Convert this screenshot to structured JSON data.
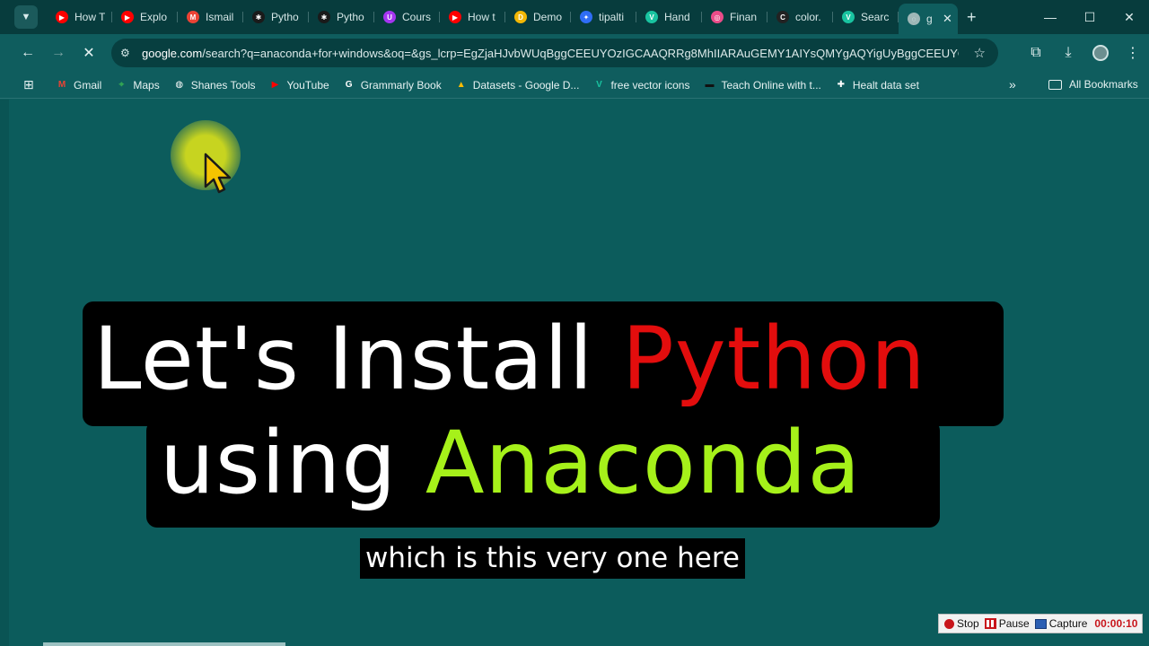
{
  "browser": {
    "tabs": [
      {
        "label": "How T",
        "icon": "youtube-icon",
        "color": "#ff0000",
        "glyph": "▶"
      },
      {
        "label": "Explo",
        "icon": "youtube-icon",
        "color": "#ff0000",
        "glyph": "▶"
      },
      {
        "label": "Ismail",
        "icon": "gmail-icon",
        "color": "#ea4335",
        "glyph": "M"
      },
      {
        "label": "Pytho",
        "icon": "openai-icon",
        "color": "#1a1a1a",
        "glyph": "✱"
      },
      {
        "label": "Pytho",
        "icon": "openai-icon",
        "color": "#1a1a1a",
        "glyph": "✱"
      },
      {
        "label": "Cours",
        "icon": "udemy-icon",
        "color": "#a435f0",
        "glyph": "U"
      },
      {
        "label": "How t",
        "icon": "youtube-icon",
        "color": "#ff0000",
        "glyph": "▶"
      },
      {
        "label": "Demo",
        "icon": "demo-icon",
        "color": "#f2b705",
        "glyph": "D"
      },
      {
        "label": "tipalti",
        "icon": "tipalti-icon",
        "color": "#2f6df6",
        "glyph": "✦"
      },
      {
        "label": "Hand",
        "icon": "vectorify-icon",
        "color": "#19c3a0",
        "glyph": "V"
      },
      {
        "label": "Finan",
        "icon": "dribbble-icon",
        "color": "#ea4c89",
        "glyph": "◎"
      },
      {
        "label": "color.",
        "icon": "coolors-icon",
        "color": "#222222",
        "glyph": "C"
      },
      {
        "label": "Searc",
        "icon": "vectorify-icon",
        "color": "#19c3a0",
        "glyph": "V"
      },
      {
        "label": "g",
        "icon": "loading-icon",
        "color": "#9fb7b7",
        "glyph": "◌",
        "active": true
      }
    ],
    "new_tab": "+",
    "window_controls": [
      "—",
      "☐",
      "✕"
    ],
    "url_domain": "google.com",
    "url_rest": "/search?q=anaconda+for+windows&oq=&gs_lcrp=EgZjaHJvbWUqBggCEEUYOzIGCAAQRRg8MhIIARAuGEMY1AIYsQMYgAQYigUyBggCEEUYOzI...",
    "bookmarks": [
      {
        "label": "Gmail",
        "icon": "gmail-icon",
        "color": "#ea4335",
        "glyph": "M"
      },
      {
        "label": "Maps",
        "icon": "maps-icon",
        "color": "#34a853",
        "glyph": "⌖"
      },
      {
        "label": "Shanes Tools",
        "icon": "globe-icon",
        "color": "#ffffff",
        "glyph": "◍"
      },
      {
        "label": "YouTube",
        "icon": "youtube-icon",
        "color": "#ff0000",
        "glyph": "▶"
      },
      {
        "label": "Grammarly Book",
        "icon": "grammarly-icon",
        "color": "#ffffff",
        "glyph": "G"
      },
      {
        "label": "Datasets - Google D...",
        "icon": "drive-icon",
        "color": "#fbbc04",
        "glyph": "▲"
      },
      {
        "label": "free vector icons",
        "icon": "vectorify-icon",
        "color": "#19c3a0",
        "glyph": "V"
      },
      {
        "label": "Teach Online with t...",
        "icon": "teachable-icon",
        "color": "#111111",
        "glyph": "▬"
      },
      {
        "label": "Healt data set",
        "icon": "kaggle-icon",
        "color": "#ffffff",
        "glyph": "✚"
      }
    ],
    "bookmarks_more": "»",
    "all_bookmarks": "All Bookmarks"
  },
  "caption": {
    "line1_a": "Let's Install ",
    "line1_b": "Python",
    "line2_a": "using ",
    "line2_b": "Anaconda",
    "subtitle": "which is this very one here"
  },
  "recorder": {
    "stop": "Stop",
    "pause": "Pause",
    "capture": "Capture",
    "time": "00:00:10"
  },
  "colors": {
    "page_bg": "#0c5c5c",
    "python_red": "#e30d0d",
    "anaconda_lime": "#a6f11a"
  }
}
